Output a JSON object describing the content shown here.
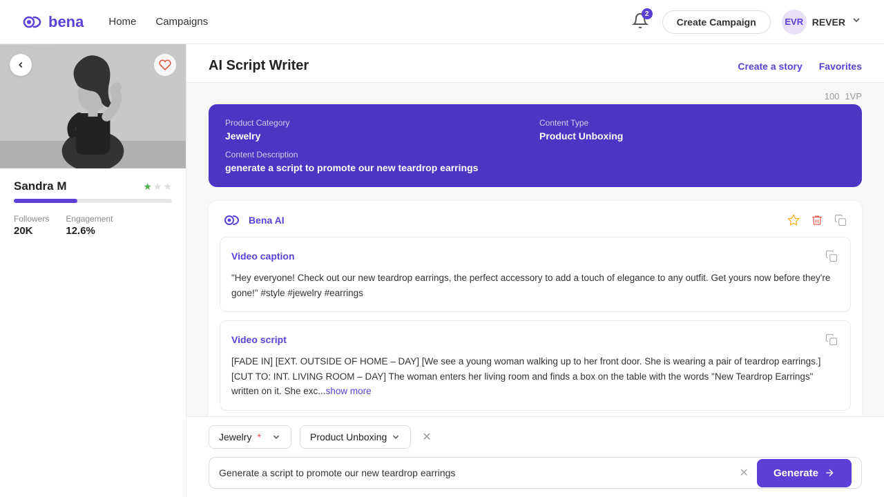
{
  "app": {
    "logo_text": "bena",
    "nav": {
      "home": "Home",
      "campaigns": "Campaigns"
    },
    "notif_count": "2",
    "create_campaign_label": "Create Campaign",
    "user": {
      "name": "REVER",
      "initials": "EVR"
    }
  },
  "profile": {
    "name": "Sandra M",
    "followers_label": "Followers",
    "followers_value": "20K",
    "engagement_label": "Engagement",
    "engagement_value": "12.6%",
    "score_percent": 40
  },
  "ai_writer": {
    "title": "AI Script Writer",
    "create_story": "Create a story",
    "favorites": "Favorites",
    "counts": {
      "label1": "100",
      "label2": "1VP"
    }
  },
  "info_box": {
    "product_category_label": "Product Category",
    "product_category_value": "Jewelry",
    "content_type_label": "Content Type",
    "content_type_value": "Product Unboxing",
    "content_description_label": "Content Description",
    "content_description_value": "generate a script to promote our new teardrop earrings"
  },
  "response": {
    "agent_name": "Bena AI",
    "video_caption_title": "Video caption",
    "video_caption_text": "\"Hey everyone! Check out our new teardrop earrings, the perfect accessory to add a touch of elegance to any outfit. Get yours now before they're gone!\" #style #jewelry #earrings",
    "video_script_title": "Video script",
    "video_script_text": "[FADE IN]\n[EXT. OUTSIDE OF HOME – DAY]\n[We see a young woman walking up to her front door. She is wearing a pair of teardrop earrings.]\n[CUT TO: INT. LIVING ROOM – DAY]\nThe woman enters her living room and finds a box on the table with the words \"New Teardrop Earrings\" written on it. She exc...",
    "show_more": "show more"
  },
  "bottom_bar": {
    "filter1_label": "Jewelry",
    "filter1_required": "*",
    "filter2_label": "Product Unboxing",
    "input_placeholder": "Generate a script to promote our new teardrop earrings",
    "generate_label": "Generate"
  }
}
